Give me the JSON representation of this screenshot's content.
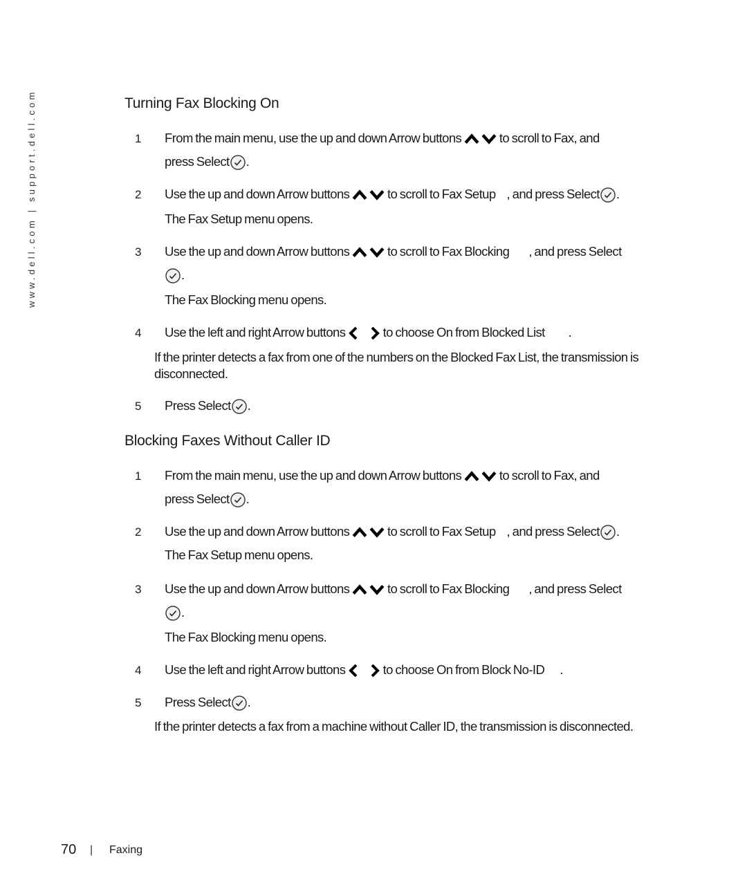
{
  "side_url": "www.dell.com | support.dell.com",
  "sections": [
    {
      "title": "Turning Fax Blocking On",
      "steps": [
        {
          "num": "1",
          "a": "From the main menu, use the up and down Arrow buttons",
          "b": "to scroll to",
          "target": "Fax",
          "c": ", and",
          "d": "press Select",
          "e": "."
        },
        {
          "num": "2",
          "a": "Use the up and down Arrow buttons",
          "b": "to scroll to",
          "target": "Fax Setup",
          "c": ", and press Select",
          "e": ".",
          "result": "The Fax Setup menu opens."
        },
        {
          "num": "3",
          "a": "Use the up and down Arrow buttons",
          "b": "to scroll to",
          "target": "Fax Blocking",
          "c": ", and press Select",
          "e": ".",
          "result": "The Fax Blocking menu opens."
        },
        {
          "num": "4",
          "a": "Use the left and right Arrow buttons",
          "b": "to choose",
          "value": "On",
          "f": "from",
          "target": "Blocked List",
          "e": ".",
          "note": "If the printer detects a fax from one of the numbers on the Blocked Fax List, the transmission is disconnected."
        },
        {
          "num": "5",
          "a": "Press Select",
          "e": "."
        }
      ]
    },
    {
      "title": "Blocking Faxes Without Caller ID",
      "steps": [
        {
          "num": "1",
          "a": "From the main menu, use the up and down Arrow buttons",
          "b": "to scroll to",
          "target": "Fax",
          "c": ", and",
          "d": "press Select",
          "e": "."
        },
        {
          "num": "2",
          "a": "Use the up and down Arrow buttons",
          "b": "to scroll to",
          "target": "Fax Setup",
          "c": ", and press Select",
          "e": ".",
          "result": "The Fax Setup menu opens."
        },
        {
          "num": "3",
          "a": "Use the up and down Arrow buttons",
          "b": "to scroll to",
          "target": "Fax Blocking",
          "c": ", and press Select",
          "e": ".",
          "result": "The Fax Blocking menu opens."
        },
        {
          "num": "4",
          "a": "Use the left and right Arrow buttons",
          "b": "to choose",
          "value": "On",
          "f": "from",
          "target": "Block No-ID",
          "e": "."
        },
        {
          "num": "5",
          "a": "Press Select",
          "e": ".",
          "note": "If the printer detects a fax from a machine without Caller ID, the transmission is disconnected."
        }
      ]
    }
  ],
  "footer": {
    "page_number": "70",
    "separator": "|",
    "chapter": "Faxing"
  }
}
